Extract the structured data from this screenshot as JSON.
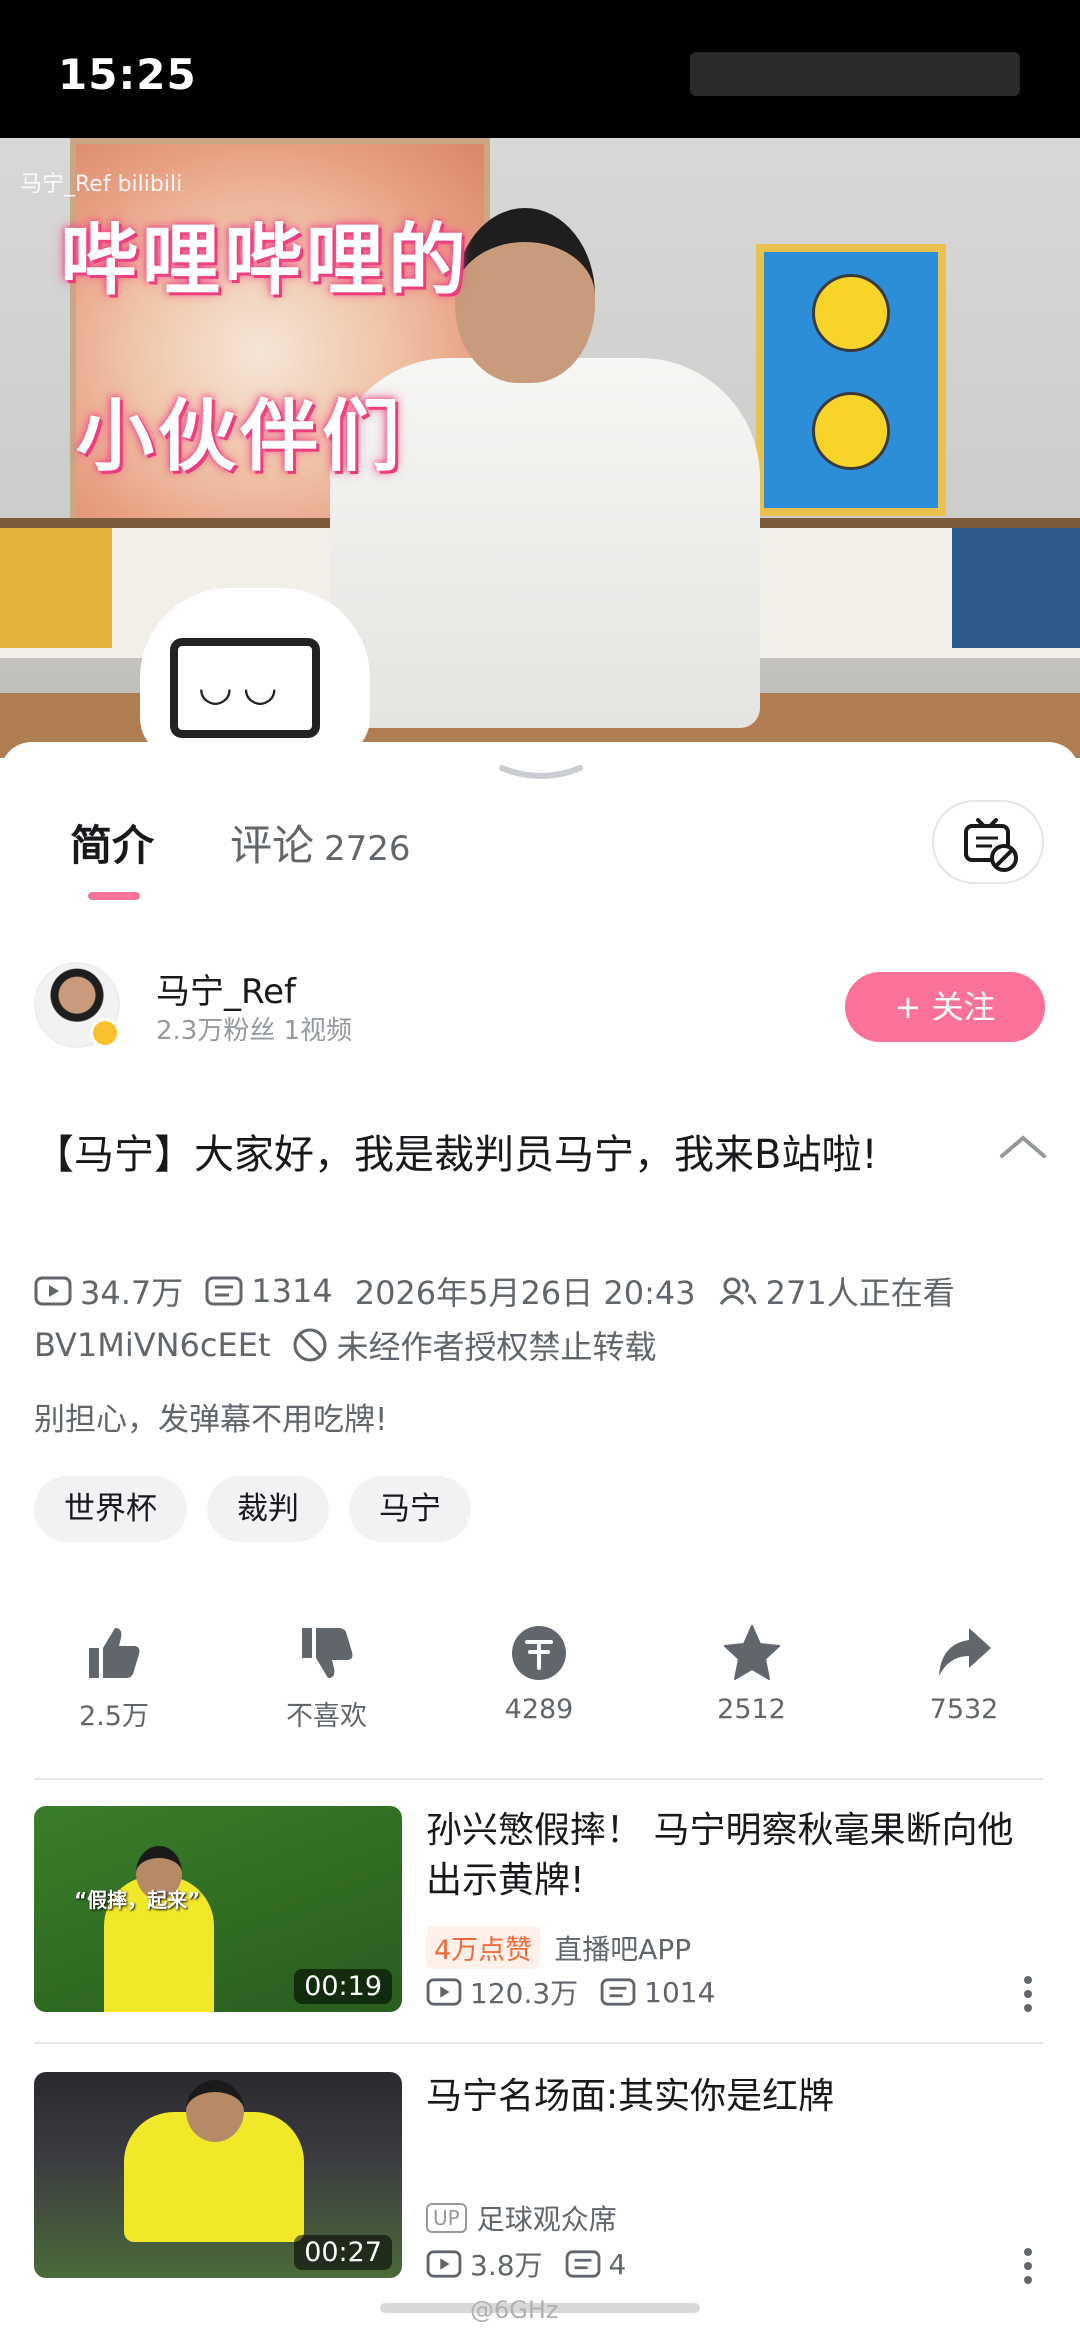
{
  "status_bar": {
    "time": "15:25"
  },
  "video": {
    "watermark": "马宁_Ref bilibili",
    "overlay_line_1": "哔哩哔哩的",
    "overlay_line_2": "小伙伴们"
  },
  "tabs": {
    "intro_label": "简介",
    "comments_label": "评论",
    "comments_count": "2726"
  },
  "uploader": {
    "name": "马宁_Ref",
    "stats": "2.3万粉丝   1视频",
    "follow_label": "+ 关注"
  },
  "video_info": {
    "title": "【马宁】大家好，我是裁判员马宁，我来B站啦!",
    "views": "34.7万",
    "danmaku": "1314",
    "datetime": "2026年5月26日 20:43",
    "watching": "271人正在看",
    "bvid": "BV1MiVN6cEEt",
    "copyright": "未经作者授权禁止转载",
    "description": "别担心，发弹幕不用吃牌!"
  },
  "tags": [
    "世界杯",
    "裁判",
    "马宁"
  ],
  "actions": {
    "like": "2.5万",
    "dislike": "不喜欢",
    "coin": "4289",
    "favorite": "2512",
    "share": "7532"
  },
  "recommendations": [
    {
      "title": "孙兴慜假摔！ 马宁明察秋毫果断向他出示黄牌!",
      "badge": "4万点赞",
      "source": "直播吧APP",
      "views": "120.3万",
      "danmaku": "1014",
      "duration": "00:19",
      "thumb_caption": "“假摔，起来”"
    },
    {
      "title": "马宁名场面:其实你是红牌",
      "up_badge": "UP",
      "source": "足球观众席",
      "views": "3.8万",
      "danmaku": "4",
      "duration": "00:27"
    }
  ],
  "footer": {
    "watermark": "@6GHz"
  },
  "colors": {
    "accent": "#fb7299",
    "text_primary": "#18191c",
    "text_secondary": "#61666d"
  }
}
